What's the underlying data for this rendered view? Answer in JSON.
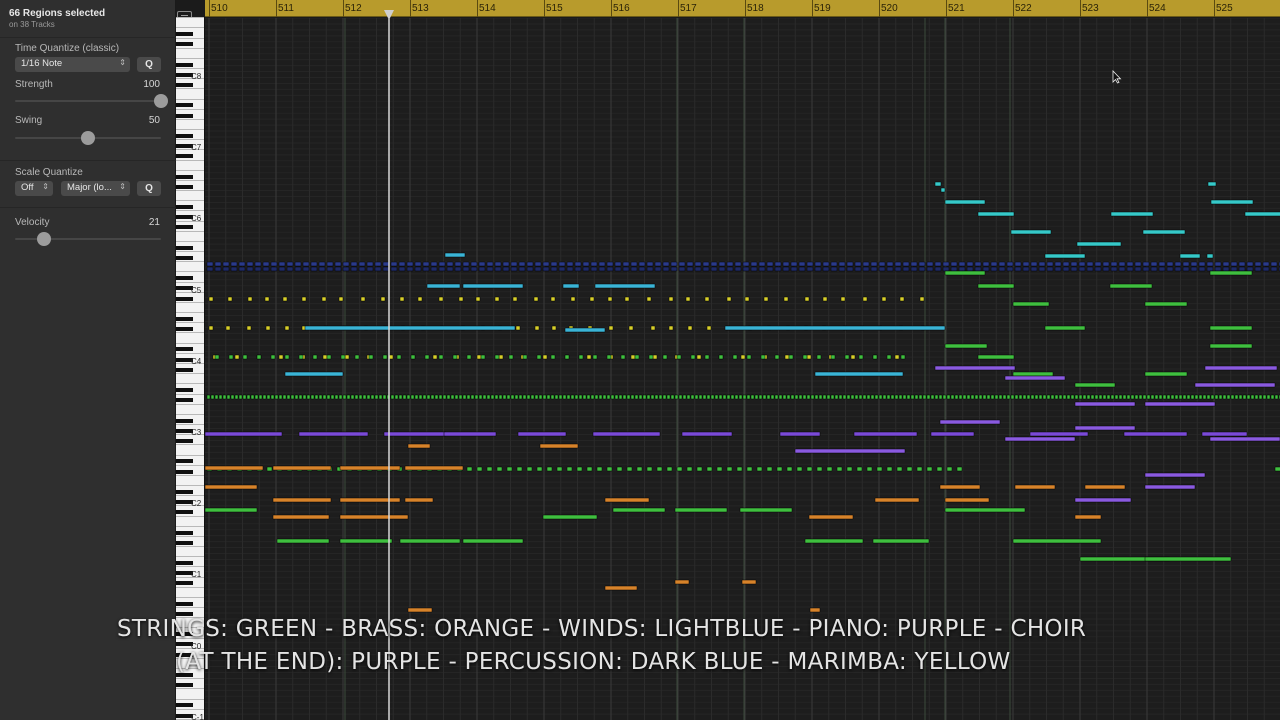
{
  "selection": {
    "title": "66 Regions selected",
    "subtitle": "on 38 Tracks"
  },
  "time_quantize": {
    "label": "Time Quantize (classic)",
    "value": "1/16 Note",
    "button": "Q"
  },
  "strength": {
    "label": "Strength",
    "value": "100",
    "level": 1.0
  },
  "swing": {
    "label": "Swing",
    "value": "50",
    "level": 0.5
  },
  "scale_quantize": {
    "label": "Scale Quantize",
    "mode": "Off",
    "scale": "Major (lo...",
    "button": "Q"
  },
  "velocity": {
    "label": "Velocity",
    "value": "21",
    "level": 0.2
  },
  "ruler": {
    "bars": [
      "510",
      "511",
      "512",
      "513",
      "514",
      "515",
      "516",
      "517",
      "518",
      "519",
      "520",
      "521",
      "522",
      "523",
      "524",
      "525"
    ]
  },
  "keyboard": {
    "octaves": [
      "C8",
      "C7",
      "C6",
      "C5",
      "C4",
      "C3",
      "C2",
      "C1",
      "C0",
      "C-1"
    ]
  },
  "colors": {
    "strings": "#3fbf3f",
    "brass": "#d7832a",
    "winds": "#3ab4d6",
    "piano": "#7a4ad8",
    "percussion": "#2a3a8a",
    "marimba": "#d8cf2a",
    "choir": "#8a5ae0",
    "ruler": "#b89b2c"
  },
  "caption": {
    "line1": "STRINGS: GREEN - BRASS: ORANGE - WINDS: LIGHTBLUE - PIANO: PURPLE - CHOIR",
    "line2": "(AT THE END): PURPLE - PERCUSSION: DARK BLUE -  MARIMBA: YELLOW"
  }
}
